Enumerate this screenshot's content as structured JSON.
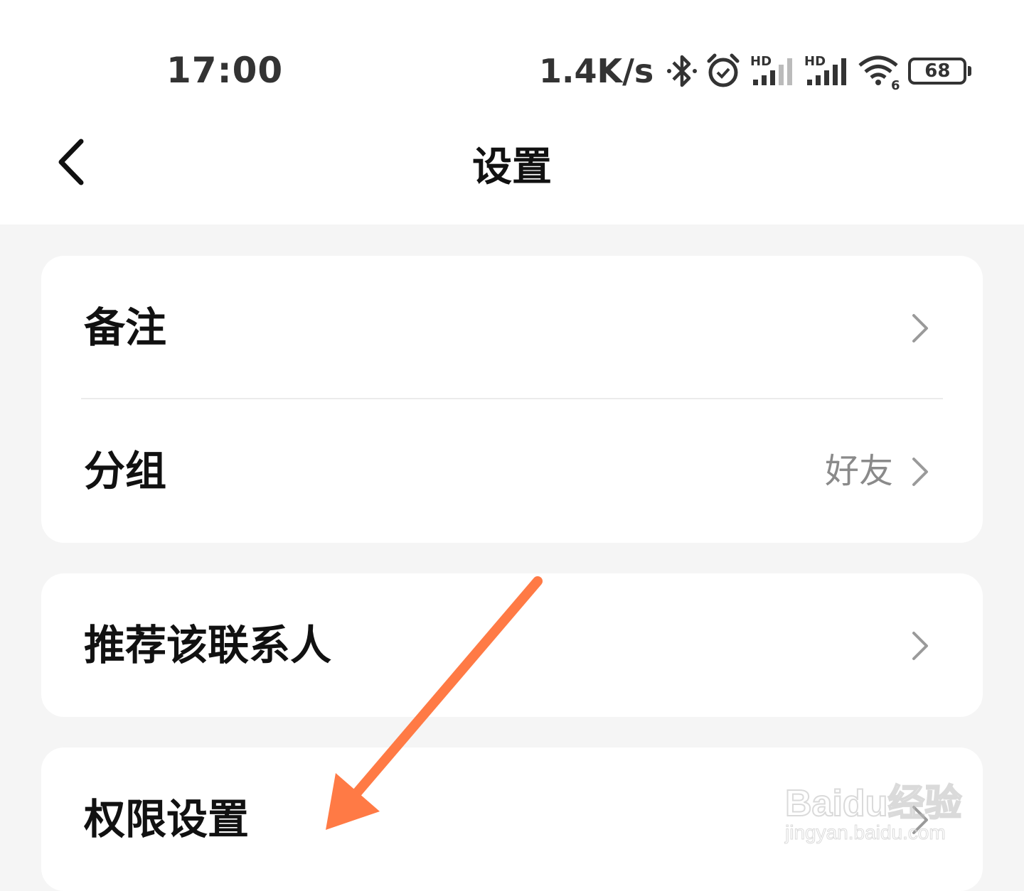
{
  "status_bar": {
    "time": "17:00",
    "net_speed": "1.4K/s",
    "battery_level": "68",
    "icons": [
      "bluetooth-icon",
      "alarm-icon",
      "signal-hd-icon",
      "signal-hd-icon",
      "wifi-icon",
      "battery-icon"
    ],
    "signal_label": "HD",
    "wifi_label": "6"
  },
  "nav": {
    "title": "设置",
    "back_icon": "chevron-left-icon"
  },
  "cards": [
    {
      "rows": [
        {
          "label": "备注",
          "value": ""
        },
        {
          "label": "分组",
          "value": "好友"
        }
      ]
    },
    {
      "rows": [
        {
          "label": "推荐该联系人",
          "value": ""
        }
      ]
    },
    {
      "rows": [
        {
          "label": "权限设置",
          "value": ""
        }
      ]
    }
  ],
  "annotation": {
    "arrow_color": "#ff7a45"
  },
  "watermark": {
    "brand": "Baidu经验",
    "url": "jingyan.baidu.com"
  }
}
